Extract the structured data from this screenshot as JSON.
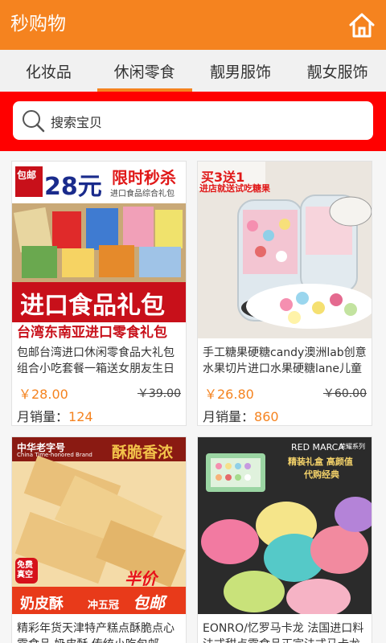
{
  "header": {
    "title": "秒购物",
    "home_icon": "home-icon",
    "background": "#f5831f"
  },
  "tabs": [
    {
      "label": "化妆品",
      "active": false
    },
    {
      "label": "休闲零食",
      "active": true
    },
    {
      "label": "靓男服饰",
      "active": false
    },
    {
      "label": "靓女服饰",
      "active": false
    }
  ],
  "search": {
    "placeholder": "搜索宝贝",
    "icon": "search-icon"
  },
  "products": [
    {
      "name": "包邮台湾进口休闲零食品大礼包组合小吃套餐一箱送女朋友生日",
      "price": "￥28.00",
      "old_price": "￥39.00",
      "sales_label": "月销量：",
      "sales": "124",
      "image_text": {
        "badge": "包邮",
        "price": "28元",
        "flash": "限时秒杀",
        "sub": "进口食品综合礼包",
        "main": "进口食品礼包",
        "bottom": "台湾东南亚进口零食礼包"
      }
    },
    {
      "name": "手工糖果硬糖candy澳洲lab创意水果切片进口水果硬糖lane儿童",
      "price": "￥26.80",
      "old_price": "￥60.00",
      "sales_label": "月销量：",
      "sales": "860",
      "image_text": {
        "promo": "买3送1",
        "sub": "进店就送试吃糖果"
      }
    },
    {
      "name": "精彩年货天津特产糕点酥脆点心零食品 奶皮酥 传统小吃包邮",
      "image_text": {
        "brand": "中华老字号",
        "brand_en": "China Time-honored Brand",
        "slogan": "酥脆香浓",
        "free": "免费真空",
        "half": "半价",
        "name": "奶皮酥",
        "award": "冲五冠",
        "ship": "包邮"
      }
    },
    {
      "name": "EONRO/忆罗马卡龙 法国进口料法式甜点零食品正宗法式马卡龙",
      "image_text": {
        "brand": "RED MARCA",
        "brand_sub": "荣耀系列",
        "line1": "精装礼盒 高颜值",
        "line2": "代购经典"
      }
    }
  ],
  "colors": {
    "accent": "#f5831f",
    "search_bg": "#ff0000"
  }
}
